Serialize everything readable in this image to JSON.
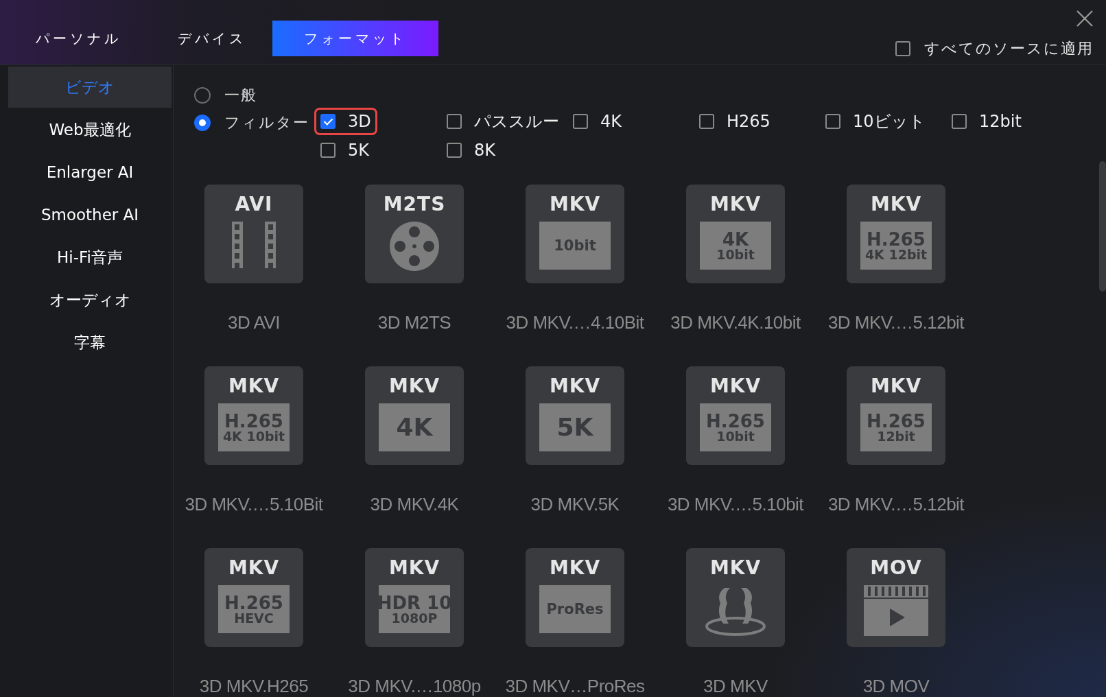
{
  "tabs": [
    {
      "label": "パーソナル",
      "selected": false
    },
    {
      "label": "デバイス",
      "selected": false
    },
    {
      "label": "フォーマット",
      "selected": true
    }
  ],
  "apply_all": {
    "label": "すべてのソースに適用",
    "checked": false
  },
  "sidebar": {
    "items": [
      {
        "label": "ビデオ",
        "selected": true
      },
      {
        "label": "Web最適化",
        "selected": false
      },
      {
        "label": "Enlarger AI",
        "selected": false
      },
      {
        "label": "Smoother AI",
        "selected": false
      },
      {
        "label": "Hi-Fi音声",
        "selected": false
      },
      {
        "label": "オーディオ",
        "selected": false
      },
      {
        "label": "字幕",
        "selected": false
      }
    ]
  },
  "modes": [
    {
      "label": "一般",
      "selected": false
    },
    {
      "label": "フィルター",
      "selected": true
    }
  ],
  "filter_rows": [
    {
      "items": [
        {
          "label": "3D",
          "checked": true,
          "highlighted": true
        },
        {
          "label": "パススルー",
          "checked": false,
          "highlighted": false
        },
        {
          "label": "4K",
          "checked": false,
          "highlighted": false
        },
        {
          "label": "H265",
          "checked": false,
          "highlighted": false
        },
        {
          "label": "10ビット",
          "checked": false,
          "highlighted": false
        },
        {
          "label": "12bit",
          "checked": false,
          "highlighted": false
        }
      ]
    },
    {
      "items": [
        {
          "label": "5K",
          "checked": false,
          "highlighted": false
        },
        {
          "label": "8K",
          "checked": false,
          "highlighted": false
        }
      ]
    }
  ],
  "formats": [
    {
      "kind": "film",
      "header": "AVI",
      "label": "3D AVI"
    },
    {
      "kind": "reel",
      "header": "M2TS",
      "label": "3D M2TS"
    },
    {
      "kind": "badge",
      "header": "MKV",
      "badge": [
        "10bit"
      ],
      "label": "3D MKV.…4.10Bit"
    },
    {
      "kind": "badge",
      "header": "MKV",
      "badge": [
        "4K",
        "10bit"
      ],
      "label": "3D MKV.4K.10bit"
    },
    {
      "kind": "badge",
      "header": "MKV",
      "badge": [
        "H.265",
        "4K 12bit"
      ],
      "label": "3D MKV.…5.12bit"
    },
    {
      "kind": "badge",
      "header": "MKV",
      "badge": [
        "H.265",
        "4K 10bit"
      ],
      "label": "3D MKV.…5.10Bit"
    },
    {
      "kind": "badge",
      "header": "MKV",
      "badge": [
        "4K"
      ],
      "label": "3D MKV.4K"
    },
    {
      "kind": "badge",
      "header": "MKV",
      "badge": [
        "5K"
      ],
      "label": "3D MKV.5K"
    },
    {
      "kind": "badge",
      "header": "MKV",
      "badge": [
        "H.265",
        "10bit"
      ],
      "label": "3D MKV.…5.10bit"
    },
    {
      "kind": "badge",
      "header": "MKV",
      "badge": [
        "H.265",
        "12bit"
      ],
      "label": "3D MKV.…5.12bit"
    },
    {
      "kind": "badge",
      "header": "MKV",
      "badge": [
        "H.265",
        "HEVC"
      ],
      "label": "3D MKV.H265"
    },
    {
      "kind": "badge",
      "header": "MKV",
      "badge": [
        "HDR 10",
        "1080P"
      ],
      "label": "3D MKV.…1080p"
    },
    {
      "kind": "badge",
      "header": "MKV",
      "badge": [
        "ProRes"
      ],
      "label": "3D MKV…ProRes"
    },
    {
      "kind": "surround",
      "header": "MKV",
      "label": "3D MKV"
    },
    {
      "kind": "clapper",
      "header": "MOV",
      "label": "3D MOV"
    }
  ]
}
